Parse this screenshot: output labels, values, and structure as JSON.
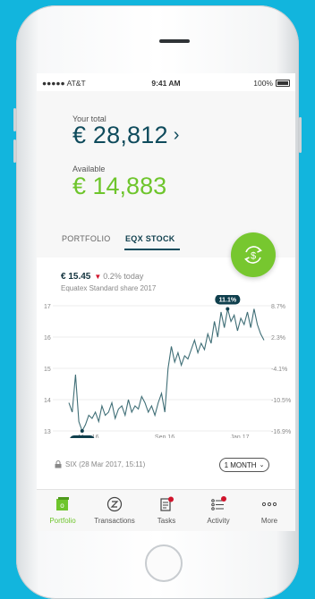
{
  "status_bar": {
    "carrier": "●●●●● AT&T",
    "time": "9:41 AM",
    "battery": "100%"
  },
  "summary": {
    "total_label": "Your total",
    "total_value": "€ 28,812",
    "available_label": "Available",
    "available_value": "€ 14,883"
  },
  "tabs": [
    {
      "label": "PORTFOLIO",
      "active": false
    },
    {
      "label": "EQX STOCK",
      "active": true
    }
  ],
  "stock": {
    "price": "€ 15.45",
    "change": "0.2% today",
    "subtitle": "Equatex Standard share 2017",
    "source": "SIX (28 Mar 2017, 15:11)",
    "period": "1 MONTH"
  },
  "chart_data": {
    "type": "line",
    "x_ticks": [
      "May 16",
      "Sep 16",
      "Jan 17"
    ],
    "y_ticks_left": [
      "17",
      "16",
      "15",
      "14",
      "13"
    ],
    "y_ticks_right": [
      "8.7%",
      "2.3%",
      "-4.1%",
      "-10.5%",
      "-16.9%"
    ],
    "ylim": [
      13,
      17
    ],
    "annotations": {
      "max_label": "11.1%",
      "min_label": "-16.0%"
    },
    "series": [
      {
        "values": [
          13.9,
          13.6,
          14.8,
          13.3,
          13.0,
          13.2,
          13.5,
          13.4,
          13.6,
          13.3,
          13.8,
          13.5,
          13.6,
          13.9,
          13.4,
          13.7,
          13.8,
          13.5,
          14.0,
          13.6,
          13.8,
          13.7,
          14.1,
          13.9,
          13.6,
          13.8,
          13.5,
          13.9,
          14.2,
          13.6,
          15.0,
          15.7,
          15.2,
          15.5,
          15.1,
          15.4,
          15.3,
          15.6,
          15.9,
          15.5,
          15.8,
          15.6,
          16.1,
          15.8,
          16.5,
          16.0,
          16.8,
          16.3,
          16.9,
          16.5,
          16.7,
          16.2,
          16.6,
          16.4,
          16.8,
          16.3,
          16.9,
          16.4,
          16.1,
          15.9
        ]
      }
    ],
    "color": "#3f6e76",
    "grid": true
  },
  "tabbar": [
    {
      "label": "Portfolio",
      "icon": "portfolio-icon",
      "active": true
    },
    {
      "label": "Transactions",
      "icon": "transactions-icon",
      "active": false
    },
    {
      "label": "Tasks",
      "icon": "tasks-icon",
      "active": false,
      "badge": true
    },
    {
      "label": "Activity",
      "icon": "activity-icon",
      "active": false,
      "badge": true
    },
    {
      "label": "More",
      "icon": "more-icon",
      "active": false
    }
  ],
  "colors": {
    "background": "#12b5dd",
    "brand_dark": "#0f4b5c",
    "brand_green": "#6ec52c",
    "negative": "#d0142c"
  }
}
